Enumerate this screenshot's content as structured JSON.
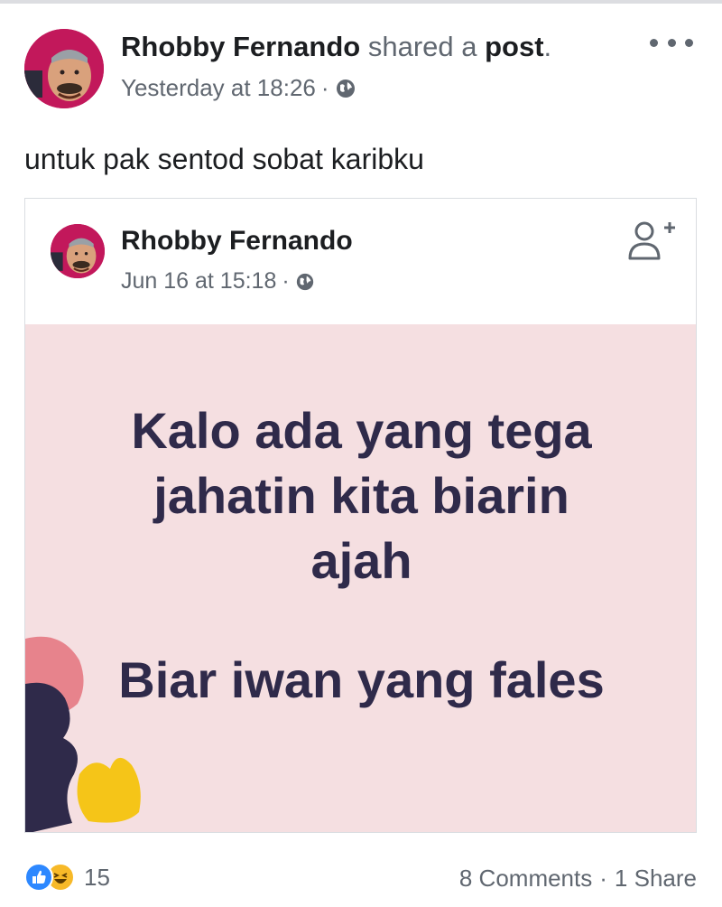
{
  "post": {
    "author": "Rhobby Fernando",
    "verb": "shared a",
    "object": "post",
    "object_suffix": ".",
    "time": "Yesterday at 18:26",
    "separator": "·",
    "audience_icon": "globe-icon",
    "more_icon": "more-horizontal-icon",
    "text": "untuk pak sentod sobat karibku"
  },
  "shared": {
    "author": "Rhobby Fernando",
    "time": "Jun 16 at 15:18",
    "separator": "·",
    "audience_icon": "globe-icon",
    "action_icon": "add-friend-icon",
    "quote_lines": [
      "Kalo ada yang tega",
      "jahatin kita biarin",
      "ajah"
    ],
    "quote_tail": "Biar iwan yang fales",
    "background_color": "#f5dfe1",
    "text_color": "#2f2a4a"
  },
  "footer": {
    "reaction_icons": [
      "like-icon",
      "haha-icon"
    ],
    "reaction_count": "15",
    "comments": "8 Comments",
    "separator": "·",
    "shares": "1 Share"
  }
}
